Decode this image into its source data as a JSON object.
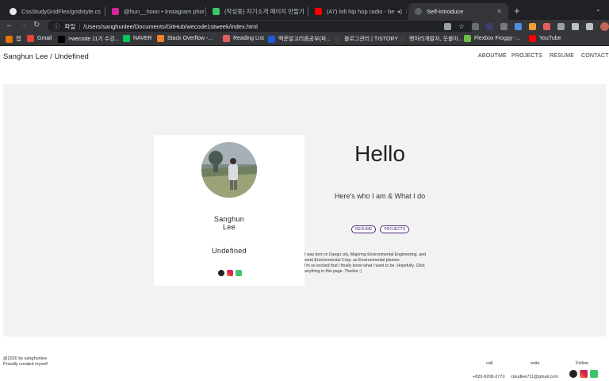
{
  "browser": {
    "tabs": [
      {
        "title": "CssStudyGridFlex/gridstyle.cs",
        "color": "#e8eaed"
      },
      {
        "title": "@hun__hoon • Instagram photo",
        "color": "#d6249f"
      },
      {
        "title": "(작성중) 자기소개 페이지 만들기 St",
        "color": "#3ec46d"
      },
      {
        "title": "(47) lofi hip hop radio - be",
        "color": "#ff0000"
      },
      {
        "title": "Self-introduce",
        "color": "#5f6368"
      }
    ],
    "address": {
      "scheme_label": "파일",
      "url": "/Users/sanghunlee/Documents/GitHub/wecode1stweek/index.html"
    },
    "bookmarks": [
      {
        "label": "앱",
        "color": "#e37400"
      },
      {
        "label": "Gmail",
        "color": "#ea4335"
      },
      {
        "label": ">wecode 11기 수강...",
        "color": "#000000"
      },
      {
        "label": "NAVER",
        "color": "#03c75a"
      },
      {
        "label": "Stack Overflow -...",
        "color": "#f48024"
      },
      {
        "label": "Reading List",
        "color": "#e25f5f"
      },
      {
        "label": "백준알고리즘공부(파...",
        "color": "#1e5bd8"
      },
      {
        "label": "블로그관리 | TISTORY",
        "color": "#3c3c3c"
      },
      {
        "label": "병아리개발자, 웃볼아...",
        "color": "#3c3c3c"
      },
      {
        "label": "Flexbox Froggy -...",
        "color": "#6cbf46"
      },
      {
        "label": "YouTube",
        "color": "#ff0000"
      }
    ]
  },
  "site": {
    "title": "Sanghun Lee / Undefined",
    "nav": [
      "ABOUTME",
      "PROJECTS",
      "RESUME",
      "CONTACT"
    ]
  },
  "profile": {
    "name_line1": "Sanghun",
    "name_line2": "Lee",
    "nickname": "Undefined"
  },
  "intro": {
    "greeting": "Hello",
    "tagline": "Here's who I am & What I do",
    "buttons": [
      "RESUME",
      "PROJECTS"
    ],
    "bio_line1": "I was born in Daegu city, Majoring Environmental Engineering. and",
    "bio_line2": "went Environmental Corp. as Environmental planner.",
    "bio_line3": "I'm so excited that I finally know what I want to be. Hopefully, Click",
    "bio_line4": "anything in this page. Thanks :)"
  },
  "footer": {
    "copyright": "@2020 by sanghunlee",
    "created": "Proudly created myself",
    "call_label": "call",
    "write_label": "write",
    "follow_label": "Follow",
    "phone": "+820-9208-2770",
    "email": "cloudlee711@gmail.com"
  },
  "colors": {
    "accent": "#4b2a7b",
    "hero_bg": "#f2f2f2"
  }
}
